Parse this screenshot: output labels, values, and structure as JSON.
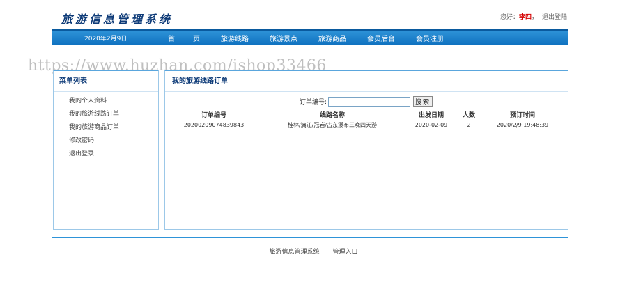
{
  "header": {
    "logo_text": "旅游信息管理系统",
    "greeting": "您好：",
    "username": "李四",
    "separator": "，",
    "logout": "退出登陆"
  },
  "navbar": {
    "date": "2020年2月9日",
    "items": [
      {
        "label": "首　页"
      },
      {
        "label": "旅游线路"
      },
      {
        "label": "旅游景点"
      },
      {
        "label": "旅游商品"
      },
      {
        "label": "会员后台"
      },
      {
        "label": "会员注册"
      }
    ]
  },
  "watermark": "https://www.huzhan.com/ishop33466",
  "sidebar": {
    "title": "菜单列表",
    "items": [
      {
        "label": "我的个人资料"
      },
      {
        "label": "我的旅游线路订单"
      },
      {
        "label": "我的旅游商品订单"
      },
      {
        "label": "修改密码"
      },
      {
        "label": "退出登录"
      }
    ]
  },
  "main": {
    "title": "我的旅游线路订单",
    "search": {
      "label": "订单编号:",
      "value": "",
      "button": "搜索"
    },
    "table": {
      "headers": [
        "订单编号",
        "线路名称",
        "出发日期",
        "人数",
        "预订时间"
      ],
      "rows": [
        [
          "20200209074839843",
          "桂林/漓江/冠岩/古东瀑布三晚四天游",
          "2020-02-09",
          "2",
          "2020/2/9 19:48:39"
        ]
      ]
    }
  },
  "footer": {
    "links": [
      "旅游信息管理系统",
      "管理入口"
    ]
  }
}
